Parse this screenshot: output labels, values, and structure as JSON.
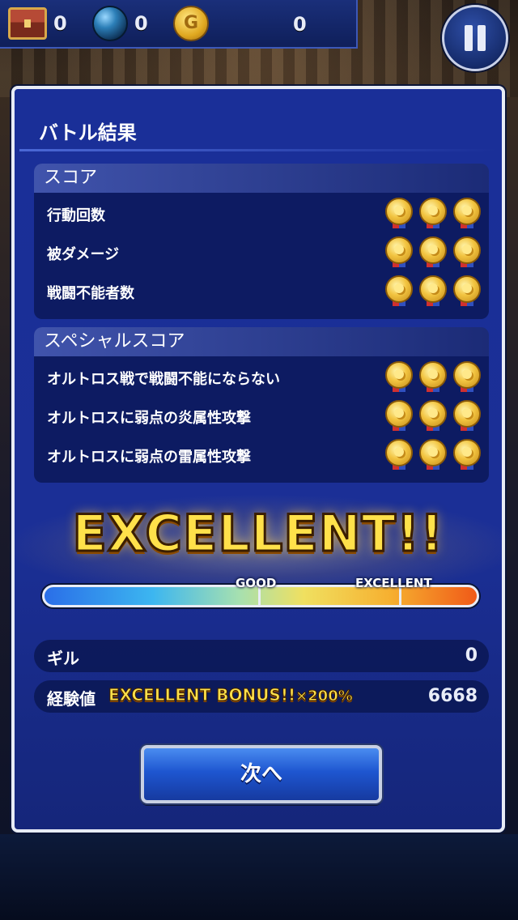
{
  "hud": {
    "items": [
      {
        "icon": "treasure-chest-icon",
        "value": "0"
      },
      {
        "icon": "orb-icon",
        "value": "0"
      },
      {
        "icon": "gil-coin-icon",
        "icon_text": "G",
        "value": "0"
      }
    ],
    "pause_icon": "pause-icon"
  },
  "panel": {
    "title": "バトル結果",
    "score": {
      "heading": "スコア",
      "rows": [
        {
          "label": "行動回数",
          "medals": 3
        },
        {
          "label": "被ダメージ",
          "medals": 3
        },
        {
          "label": "戦闘不能者数",
          "medals": 3
        }
      ]
    },
    "special": {
      "heading": "スペシャルスコア",
      "rows": [
        {
          "label": "オルトロス戦で戦闘不能にならない",
          "medals": 3
        },
        {
          "label": "オルトロスに弱点の炎属性攻撃",
          "medals": 3
        },
        {
          "label": "オルトロスに弱点の雷属性攻撃",
          "medals": 3
        }
      ]
    },
    "rating": "EXCELLENT!!",
    "gauge": {
      "good_label": "GOOD",
      "excellent_label": "EXCELLENT"
    },
    "rewards": {
      "gil_label": "ギル",
      "gil_value": "0",
      "exp_label": "経験値",
      "exp_bonus": "EXCELLENT BONUS!!",
      "exp_bonus_multiplier": "×200%",
      "exp_value": "6668"
    },
    "next_button": "次へ"
  },
  "colors": {
    "panel": "#1b2f96",
    "gold": "#ffe14a",
    "border": "#e8ecf6"
  }
}
